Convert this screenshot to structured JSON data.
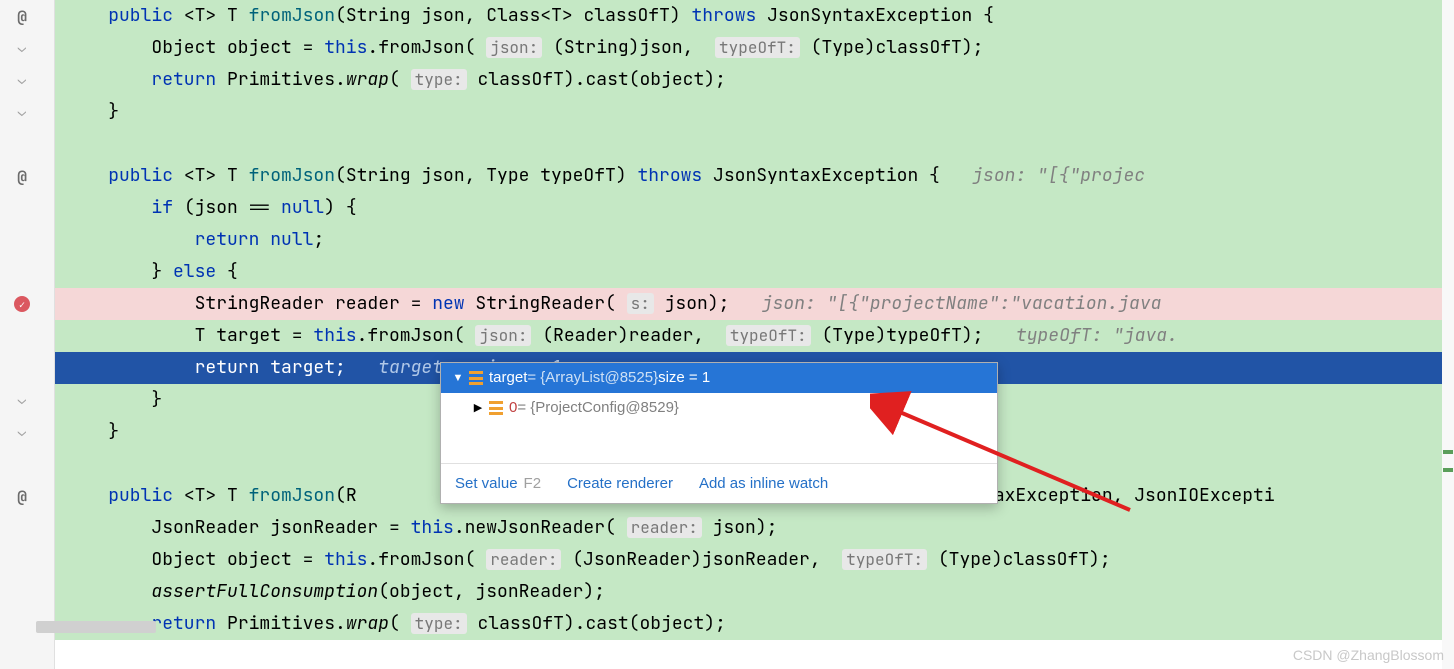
{
  "lines": {
    "l0": {
      "sig_pre": "public",
      "generic": "<T>",
      "ret": "T",
      "name": "fromJson",
      "params": "(String json, Class<T> classOfT)",
      "throws_kw": "throws",
      "exc": "JsonSyntaxException {"
    },
    "l1": {
      "pre": "        Object object = ",
      "this_kw": "this",
      "call": ".fromJson(",
      "hint1": "json:",
      "mid1": " (String)json, ",
      "hint2": "typeOfT:",
      "mid2": " (Type)classOfT);"
    },
    "l2": {
      "pre": "        ",
      "ret_kw": "return",
      "mid": " Primitives.",
      "wrap": "wrap",
      "open": "(",
      "hint": "type:",
      "rest": " classOfT).cast(object);"
    },
    "l3": "    }",
    "l5": {
      "pre": "    ",
      "pub": "public",
      "gen": " <T> T ",
      "name": "fromJson",
      "params": "(String json, Type typeOfT) ",
      "throws_kw": "throws",
      "exc": " JsonSyntaxException {",
      "dbg": "   json: \"[{\"projec"
    },
    "l6": {
      "pre": "        ",
      "if_kw": "if",
      "cond": " (json == ",
      "null_kw": "null",
      "end": ") {"
    },
    "l7": {
      "pre": "            ",
      "ret_kw": "return",
      "sp": " ",
      "null_kw": "null",
      "end": ";"
    },
    "l8": {
      "pre": "        } ",
      "else_kw": "else",
      "end": " {"
    },
    "l9": {
      "pre": "            StringReader reader = ",
      "new_kw": "new",
      "mid": " StringReader(",
      "hint": "s:",
      "rest": " json);",
      "dbg": "   json: \"[{\"projectName\":\"vacation.java"
    },
    "l10": {
      "pre": "            T target = ",
      "this_kw": "this",
      "call": ".fromJson(",
      "hint1": "json:",
      "mid1": " (Reader)reader, ",
      "hint2": "typeOfT:",
      "mid2": " (Type)typeOfT);",
      "dbg": "   typeOfT: \"java."
    },
    "l11": {
      "pre": "            ",
      "ret_kw": "return",
      "rest": " target;",
      "dbg": "   target:  size = 1"
    },
    "l12": "        }",
    "l13": "    }",
    "l15": {
      "pre": "    ",
      "pub": "public",
      "gen": " <T> T ",
      "name": "fromJson",
      "rest": "(R                                                     onSyntaxException, JsonIOExcepti"
    },
    "l16": {
      "pre": "        JsonReader jsonReader = ",
      "this_kw": "this",
      "mid": ".newJsonReader(",
      "hint": "reader:",
      "rest": " json);"
    },
    "l17": {
      "pre": "        Object object = ",
      "this_kw": "this",
      "call": ".fromJson(",
      "hint1": "reader:",
      "mid1": " (JsonReader)jsonReader, ",
      "hint2": "typeOfT:",
      "mid2": " (Type)classOfT);"
    },
    "l18": {
      "pre": "        ",
      "fn": "assertFullConsumption",
      "rest": "(object, jsonReader);"
    },
    "l19": {
      "pre": "        ",
      "ret_kw": "return",
      "mid": " Primitives.",
      "wrap": "wrap",
      "open": "(",
      "hint": "type:",
      "rest": " classOfT).cast(object);"
    }
  },
  "popup": {
    "var_name": "target",
    "var_value": " = {ArrayList@8525} ",
    "var_size": " size = 1",
    "item_idx": "0",
    "item_val": " = {ProjectConfig@8529}",
    "actions": {
      "set_value": "Set value",
      "shortcut": "F2",
      "create_renderer": "Create renderer",
      "add_watch": "Add as inline watch"
    }
  },
  "watermark": "CSDN @ZhangBlossom"
}
